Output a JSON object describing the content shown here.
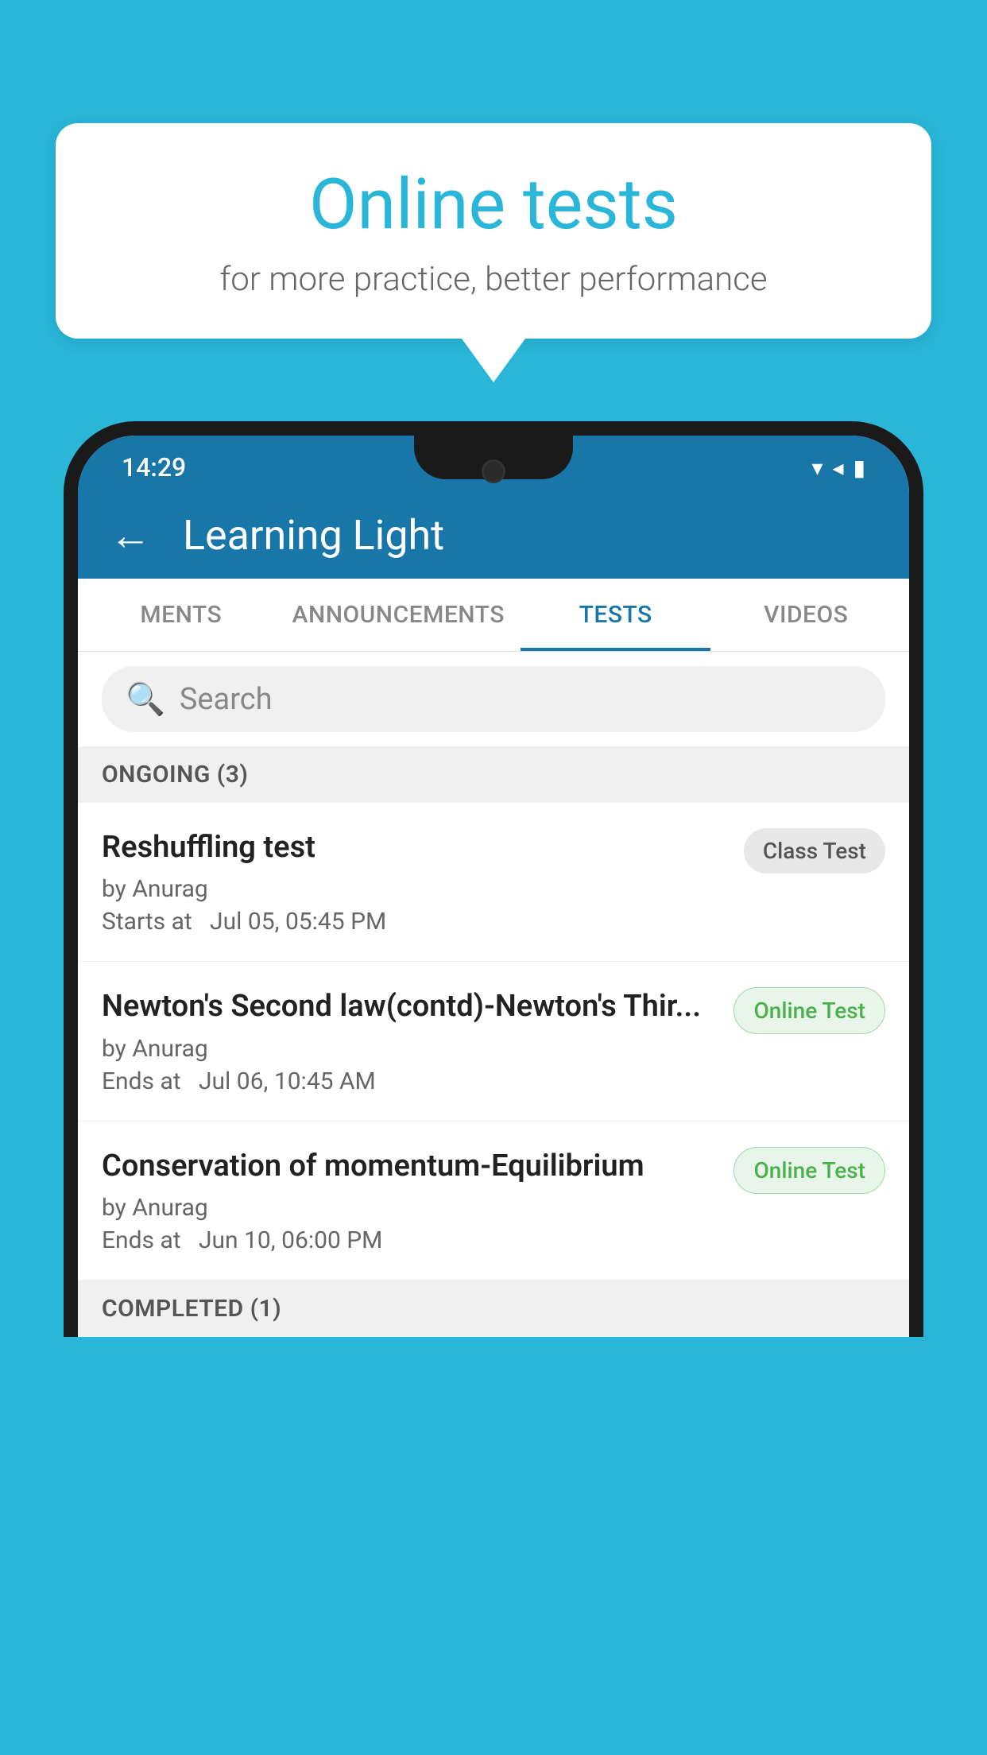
{
  "background_color": "#29b6d8",
  "speech_bubble": {
    "title": "Online tests",
    "subtitle": "for more practice, better performance"
  },
  "phone": {
    "status_bar": {
      "time": "14:29",
      "icons": [
        "wifi",
        "signal",
        "battery"
      ]
    },
    "app_bar": {
      "back_label": "←",
      "title": "Learning Light"
    },
    "tabs": [
      {
        "label": "MENTS",
        "active": false
      },
      {
        "label": "ANNOUNCEMENTS",
        "active": false
      },
      {
        "label": "TESTS",
        "active": true
      },
      {
        "label": "VIDEOS",
        "active": false
      }
    ],
    "search": {
      "placeholder": "Search"
    },
    "sections": [
      {
        "header": "ONGOING (3)",
        "items": [
          {
            "name": "Reshuffling test",
            "author": "by Anurag",
            "time_label": "Starts at",
            "time": "Jul 05, 05:45 PM",
            "badge": "Class Test",
            "badge_type": "class"
          },
          {
            "name": "Newton's Second law(contd)-Newton's Thir...",
            "author": "by Anurag",
            "time_label": "Ends at",
            "time": "Jul 06, 10:45 AM",
            "badge": "Online Test",
            "badge_type": "online"
          },
          {
            "name": "Conservation of momentum-Equilibrium",
            "author": "by Anurag",
            "time_label": "Ends at",
            "time": "Jun 10, 06:00 PM",
            "badge": "Online Test",
            "badge_type": "online"
          }
        ]
      }
    ],
    "completed_section_header": "COMPLETED (1)"
  }
}
